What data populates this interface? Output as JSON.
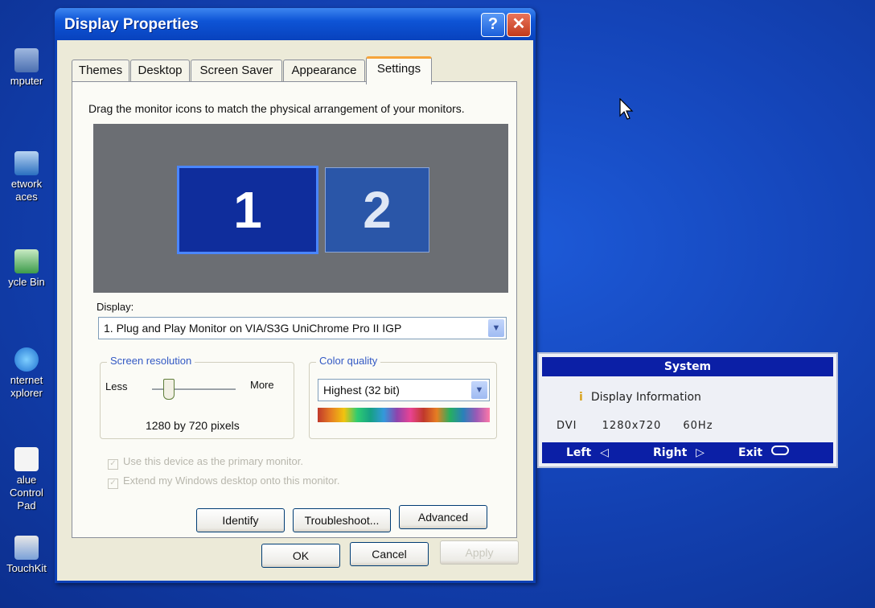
{
  "desktop": {
    "icons": [
      {
        "label": "mputer"
      },
      {
        "label": "etwork\naces"
      },
      {
        "label": "ycle Bin"
      },
      {
        "label": "nternet\nxplorer"
      },
      {
        "label": "alue Control\nPad"
      },
      {
        "label": "TouchKit"
      }
    ]
  },
  "window": {
    "title": "Display Properties",
    "help_glyph": "?",
    "close_glyph": "✕",
    "tabs": [
      "Themes",
      "Desktop",
      "Screen Saver",
      "Appearance",
      "Settings"
    ],
    "active_tab": "Settings",
    "instruction": "Drag the monitor icons to match the physical arrangement of your monitors.",
    "monitors": [
      "1",
      "2"
    ],
    "display_label": "Display:",
    "display_value": "1. Plug and Play Monitor on VIA/S3G UniChrome Pro II IGP",
    "resolution": {
      "title": "Screen resolution",
      "less": "Less",
      "more": "More",
      "value": "1280 by 720 pixels"
    },
    "color_quality": {
      "title": "Color quality",
      "value": "Highest (32 bit)"
    },
    "checkboxes": [
      {
        "label": "Use this device as the primary monitor.",
        "checked": true,
        "enabled": false
      },
      {
        "label": "Extend my Windows desktop onto this monitor.",
        "checked": true,
        "enabled": false
      }
    ],
    "buttons": {
      "identify": "Identify",
      "troubleshoot": "Troubleshoot...",
      "advanced": "Advanced",
      "ok": "OK",
      "cancel": "Cancel",
      "apply": "Apply"
    }
  },
  "osd": {
    "header": "System",
    "info_icon": "i",
    "info": "Display Information",
    "input": "DVI",
    "resolution": "1280x720",
    "refresh": "60Hz",
    "left": "Left",
    "left_glyph": "◁",
    "right": "Right",
    "right_glyph": "▷",
    "exit": "Exit"
  },
  "colors": {
    "desktop": "#1444b8",
    "titlebar": "#0e54d6",
    "osd_bar": "#0b1fa6"
  }
}
